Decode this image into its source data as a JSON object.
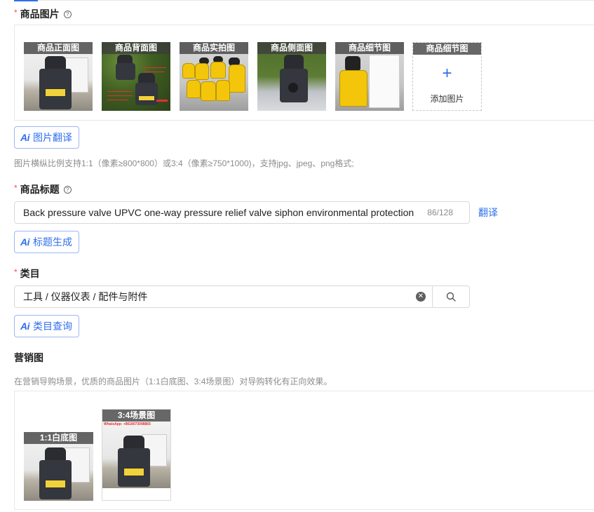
{
  "product_images": {
    "label": "商品图片",
    "required_mark": "*",
    "help_icon": "question-circle-icon",
    "images": [
      {
        "caption": "商品正面图",
        "scene": "valve-front-white-bg"
      },
      {
        "caption": "商品背面图",
        "scene": "valve-back-annotated"
      },
      {
        "caption": "商品实拍图",
        "scene": "yellow-valves-group"
      },
      {
        "caption": "商品侧面图",
        "scene": "valve-side-grass"
      },
      {
        "caption": "商品细节图",
        "scene": "yellow-valve-detail"
      }
    ],
    "add_tile": {
      "caption": "商品细节图",
      "plus": "+",
      "label": "添加图片"
    },
    "ai_button": {
      "icon": "Ai",
      "label": "图片翻译"
    },
    "hint": "图片横纵比例支持1:1（像素≥800*800）或3:4（像素≥750*1000)，支持jpg、jpeg、png格式;"
  },
  "product_title": {
    "label": "商品标题",
    "required_mark": "*",
    "help_icon": "question-circle-icon",
    "value": "Back pressure valve UPVC one-way pressure relief valve siphon environmental protection",
    "counter": "86/128",
    "translate_link": "翻译",
    "ai_button": {
      "icon": "Ai",
      "label": "标题生成"
    }
  },
  "category": {
    "label": "类目",
    "required_mark": "*",
    "value": "工具 / 仪器仪表 / 配件与附件",
    "clear_icon": "close-circle-icon",
    "search_icon": "search-icon",
    "ai_button": {
      "icon": "Ai",
      "label": "类目查询"
    }
  },
  "marketing": {
    "label": "营销图",
    "hint": "在营销导购场景，优质的商品图片（1:1白底图、3:4场景图）对导购转化有正向效果。",
    "images": [
      {
        "caption": "1:1白底图"
      },
      {
        "caption": "3:4场景图",
        "overlay_text": "WhatsApp: +8618073098865"
      }
    ]
  },
  "colors": {
    "accent": "#2f6fec",
    "required": "#ff4d4f",
    "caption_bg": "#3c3c3c",
    "valve_label": "#f2d23a"
  }
}
